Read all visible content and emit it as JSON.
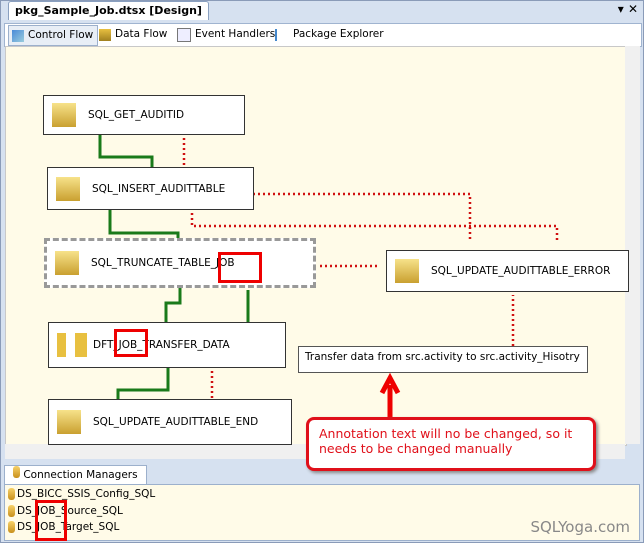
{
  "document_tab": "pkg_Sample_Job.dtsx [Design]",
  "window_controls": {
    "dropdown": "▾",
    "close": "✕"
  },
  "tabs": [
    {
      "label": "Control Flow",
      "active": true
    },
    {
      "label": "Data Flow"
    },
    {
      "label": "Event Handlers"
    },
    {
      "label": "Package Explorer"
    }
  ],
  "tasks": {
    "get_auditid": "SQL_GET_AUDITID",
    "insert_audittable": "SQL_INSERT_AUDITTABLE",
    "truncate_table": "SQL_TRUNCATE_TABLE_JOB",
    "update_error": "SQL_UPDATE_AUDITTABLE_ERROR",
    "dft_transfer": "DFT_JOB_TRANSFER_DATA",
    "update_end": "SQL_UPDATE_AUDITTABLE_END"
  },
  "annotation": "Transfer data from src.activity to src.activity_Hisotry",
  "callout": "Annotation text will no be changed, so it needs to be changed manually",
  "connection_managers": {
    "tab": "Connection Managers",
    "items": [
      "DS_BICC_SSIS_Config_SQL",
      "DS_JOB_Source_SQL",
      "DS_JOB_Target_SQL"
    ]
  },
  "watermark": "SQLYoga.com",
  "colors": {
    "success": "#1a7a1a",
    "failure": "#d01010",
    "highlight": "#e00000"
  }
}
